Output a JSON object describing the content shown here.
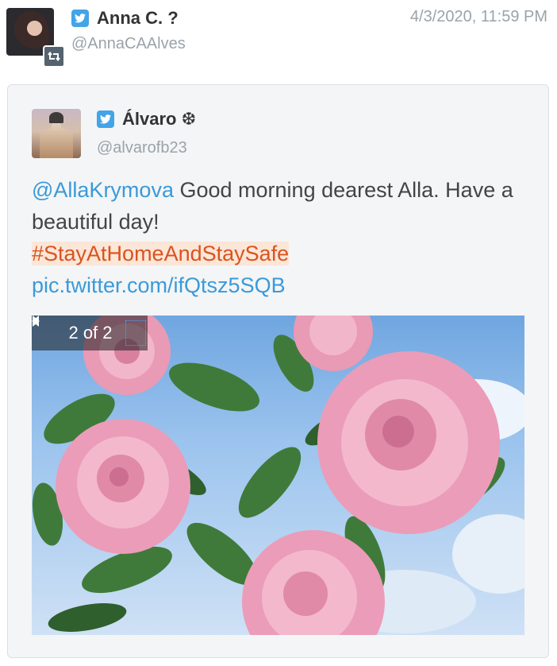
{
  "retweeter": {
    "name": "Anna C. ?",
    "handle": "@AnnaCAAlves",
    "timestamp": "4/3/2020, 11:59 PM"
  },
  "tweet": {
    "author_name": "Álvaro ❆",
    "author_handle": "@alvarofb23",
    "mention": "@AllaKrymova",
    "text": "Good morning dearest Alla. Have a beautiful day!",
    "hashtag": "#StayAtHomeAndStaySafe",
    "link": "pic.twitter.com/ifQtsz5SQB"
  },
  "carousel": {
    "counter": "2 of 2",
    "current": 2,
    "total": 2
  },
  "icons": {
    "network": "twitter-bird-icon",
    "retweet": "retweet-icon",
    "prev": "caret-left-icon",
    "next": "caret-right-icon"
  },
  "colors": {
    "twitter_blue": "#43a4e7",
    "link_blue": "#3a9ad9",
    "hashtag_orange": "#d9541e",
    "muted_gray": "#9aa3ab"
  }
}
